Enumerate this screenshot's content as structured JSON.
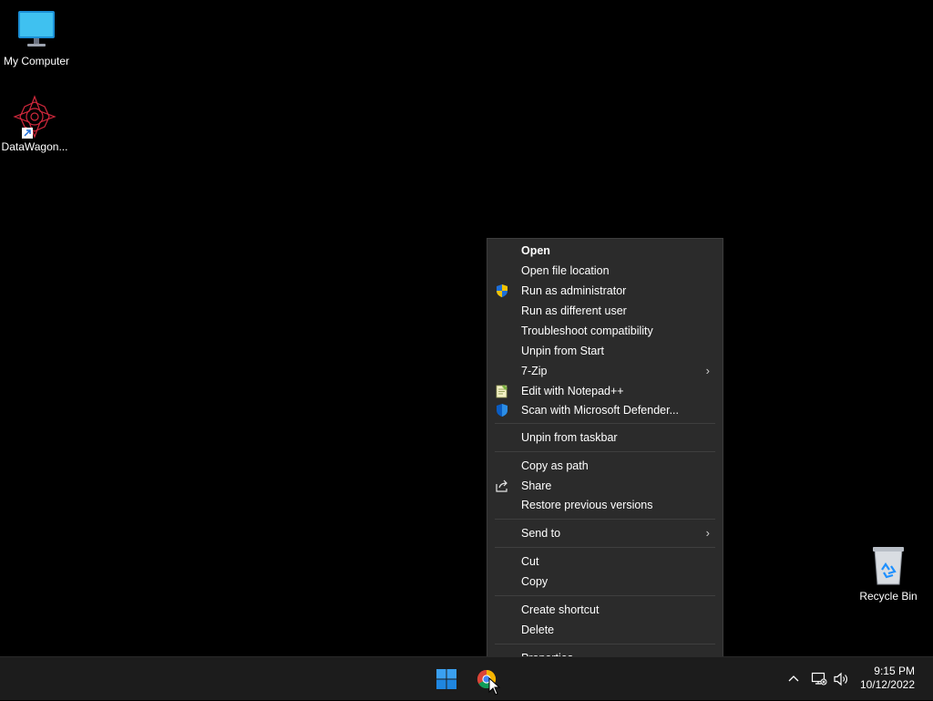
{
  "desktop": {
    "icons": [
      {
        "label": "My Computer",
        "icon": "monitor-icon"
      },
      {
        "label": "DataWagon...",
        "icon": "datawagon-app-icon"
      },
      {
        "label": "Recycle Bin",
        "icon": "recycle-bin-icon"
      }
    ]
  },
  "context_menu": {
    "items": [
      {
        "label": "Open",
        "bold": true
      },
      {
        "label": "Open file location"
      },
      {
        "label": "Run as administrator",
        "icon": "uac-shield-icon"
      },
      {
        "label": "Run as different user"
      },
      {
        "label": "Troubleshoot compatibility"
      },
      {
        "label": "Unpin from Start"
      },
      {
        "label": "7-Zip",
        "submenu": true
      },
      {
        "label": "Edit with Notepad++",
        "icon": "notepad-plus-plus-icon"
      },
      {
        "label": "Scan with Microsoft Defender...",
        "icon": "defender-shield-icon"
      },
      {
        "label": "Unpin from taskbar"
      },
      {
        "label": "Copy as path"
      },
      {
        "label": "Share",
        "icon": "share-icon"
      },
      {
        "label": "Restore previous versions"
      },
      {
        "label": "Send to",
        "submenu": true
      },
      {
        "label": "Cut"
      },
      {
        "label": "Copy"
      },
      {
        "label": "Create shortcut"
      },
      {
        "label": "Delete"
      },
      {
        "label": "Properties"
      }
    ],
    "submenu_arrow": "›"
  },
  "taskbar": {
    "start_icon": "windows-start-icon",
    "pinned": [
      {
        "icon": "chrome-icon"
      }
    ],
    "tray": {
      "overflow_icon": "chevron-up-icon",
      "network_icon": "network-icon",
      "volume_icon": "volume-icon"
    },
    "clock": {
      "time": "9:15 PM",
      "date": "10/12/2022"
    }
  },
  "colors": {
    "desktop_bg": "#000000",
    "menu_bg": "#2b2b2b",
    "taskbar_bg": "#1c1c1c",
    "windows_blue": "#0078d4"
  }
}
